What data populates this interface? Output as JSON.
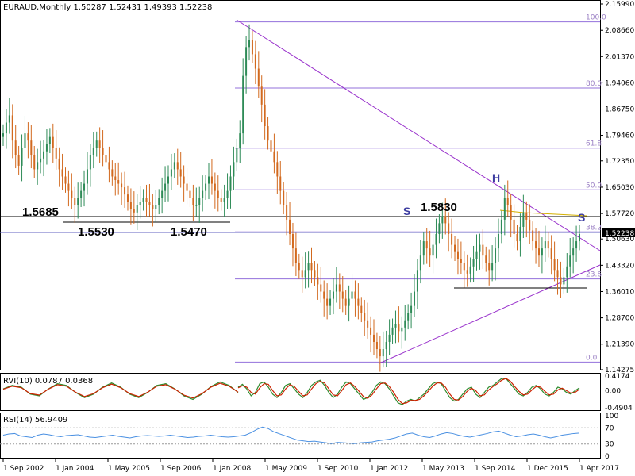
{
  "header": {
    "main": "EURAUD,Monthly  1.50287 1.52431 1.49393 1.52238",
    "rvi": "RVI(10) 0.0787 0.0368",
    "rsi": "RSI(14) 56.9409"
  },
  "current_price": "1.52238",
  "colors": {
    "bull": "#2e8b57",
    "bear": "#d2691e",
    "fib": "#9370db",
    "trend": "#9932cc",
    "support": "#000000",
    "rvi_main": "#2e8b2e",
    "rvi_signal": "#cc2200",
    "rsi": "#4a90e2",
    "pattern_text": "#3c3ca0"
  },
  "chart_data": [
    {
      "type": "candlestick",
      "symbol": "EURAUD",
      "timeframe": "Monthly",
      "ylim": [
        1.1427,
        2.1599
      ],
      "y_ticks": [
        "2.15990",
        "2.08660",
        "2.01370",
        "1.94060",
        "1.86750",
        "1.79460",
        "1.72350",
        "1.65030",
        "1.57720",
        "1.50630",
        "1.43320",
        "1.36010",
        "1.28700",
        "1.21390",
        "1.14275"
      ],
      "x_ticks": [
        "1 Sep 2002",
        "1 Jan 2004",
        "1 May 2005",
        "1 Sep 2006",
        "1 Jan 2008",
        "1 May 2009",
        "1 Sep 2010",
        "1 Jan 2012",
        "1 May 2013",
        "1 Sep 2014",
        "1 Dec 2015",
        "1 Apr 2017"
      ],
      "close_series": [
        1.8,
        1.83,
        1.85,
        1.78,
        1.74,
        1.71,
        1.76,
        1.8,
        1.78,
        1.74,
        1.7,
        1.72,
        1.73,
        1.75,
        1.77,
        1.79,
        1.76,
        1.73,
        1.7,
        1.68,
        1.66,
        1.64,
        1.62,
        1.6,
        1.62,
        1.64,
        1.66,
        1.7,
        1.74,
        1.76,
        1.78,
        1.76,
        1.74,
        1.72,
        1.7,
        1.68,
        1.67,
        1.66,
        1.65,
        1.63,
        1.61,
        1.59,
        1.58,
        1.6,
        1.61,
        1.62,
        1.61,
        1.6,
        1.59,
        1.6,
        1.62,
        1.64,
        1.66,
        1.68,
        1.7,
        1.72,
        1.7,
        1.68,
        1.66,
        1.64,
        1.62,
        1.6,
        1.6,
        1.62,
        1.64,
        1.66,
        1.68,
        1.66,
        1.64,
        1.62,
        1.61,
        1.62,
        1.64,
        1.68,
        1.72,
        1.76,
        1.8,
        1.96,
        2.04,
        2.06,
        2.02,
        1.98,
        1.93,
        1.88,
        1.82,
        1.78,
        1.75,
        1.72,
        1.68,
        1.64,
        1.6,
        1.56,
        1.52,
        1.48,
        1.44,
        1.42,
        1.4,
        1.42,
        1.44,
        1.42,
        1.4,
        1.38,
        1.36,
        1.34,
        1.32,
        1.34,
        1.36,
        1.38,
        1.36,
        1.34,
        1.32,
        1.34,
        1.36,
        1.34,
        1.32,
        1.3,
        1.28,
        1.26,
        1.24,
        1.22,
        1.2,
        1.18,
        1.2,
        1.22,
        1.24,
        1.26,
        1.27,
        1.25,
        1.26,
        1.28,
        1.3,
        1.32,
        1.36,
        1.42,
        1.46,
        1.5,
        1.48,
        1.46,
        1.49,
        1.52,
        1.55,
        1.57,
        1.55,
        1.52,
        1.49,
        1.47,
        1.45,
        1.44,
        1.42,
        1.41,
        1.43,
        1.45,
        1.47,
        1.49,
        1.46,
        1.44,
        1.42,
        1.44,
        1.48,
        1.52,
        1.56,
        1.62,
        1.6,
        1.56,
        1.52,
        1.5,
        1.54,
        1.58,
        1.56,
        1.53,
        1.5,
        1.48,
        1.46,
        1.48,
        1.5,
        1.48,
        1.45,
        1.42,
        1.4,
        1.38,
        1.4,
        1.43,
        1.46,
        1.48,
        1.5,
        1.52
      ],
      "annotations": [
        "1.5685",
        "1.5530",
        "1.5470",
        "1.5830",
        "S",
        "H",
        "S"
      ],
      "fibonacci_levels": [
        {
          "label": "100.0",
          "value": 2.11
        },
        {
          "label": "80.0",
          "value": 1.926
        },
        {
          "label": "61.8",
          "value": 1.759
        },
        {
          "label": "50.0",
          "value": 1.643
        },
        {
          "label": "38.2",
          "value": 1.526
        },
        {
          "label": "23.6",
          "value": 1.395
        },
        {
          "label": "0.0",
          "value": 1.164
        }
      ]
    },
    {
      "type": "line",
      "name": "RVI(10)",
      "y_ticks": [
        "0.4174",
        "0.00",
        "-0.4904"
      ],
      "ylim": [
        -0.4904,
        0.4174
      ],
      "series": [
        {
          "name": "main",
          "values": [
            0.1,
            0.18,
            0.05,
            -0.15,
            -0.05,
            0.2,
            0.25,
            0.1,
            -0.1,
            -0.2,
            -0.05,
            0.15,
            0.2,
            0.05,
            -0.1,
            -0.2,
            -0.05,
            0.15,
            0.25,
            0.3,
            0.15,
            -0.05,
            -0.2,
            -0.1,
            0.1,
            0.25,
            0.2,
            0.05,
            -0.1,
            -0.25,
            -0.2,
            -0.05,
            0.15,
            0.25,
            0.2,
            0.05,
            -0.15,
            -0.35,
            -0.4,
            -0.3,
            -0.25,
            -0.3,
            -0.2,
            -0.1,
            0.05,
            0.2,
            0.25,
            0.2,
            0.0,
            -0.2,
            -0.3,
            -0.25,
            -0.1,
            0.05,
            0.1,
            -0.1,
            -0.2,
            -0.05,
            0.1,
            0.15,
            0.25,
            0.35,
            0.35,
            0.2,
            0.05,
            -0.1,
            -0.15,
            -0.05,
            0.1,
            0.15,
            0.05,
            -0.1,
            -0.15,
            -0.05,
            0.1,
            0.05,
            -0.05,
            -0.1,
            0.0,
            0.08
          ]
        },
        {
          "name": "signal",
          "values": [
            0.08,
            0.14,
            0.1,
            -0.05,
            -0.1,
            0.08,
            0.2,
            0.18,
            0.0,
            -0.15,
            -0.12,
            0.05,
            0.17,
            0.12,
            -0.02,
            -0.15,
            -0.12,
            0.05,
            0.2,
            0.27,
            0.22,
            0.05,
            -0.12,
            -0.15,
            0.0,
            0.17,
            0.22,
            0.12,
            -0.02,
            -0.17,
            -0.22,
            -0.12,
            0.05,
            0.2,
            0.22,
            0.12,
            -0.05,
            -0.25,
            -0.37,
            -0.35,
            -0.28,
            -0.28,
            -0.25,
            -0.15,
            -0.02,
            0.12,
            0.22,
            0.22,
            0.1,
            -0.1,
            -0.25,
            -0.27,
            -0.17,
            -0.02,
            0.07,
            0.0,
            -0.15,
            -0.12,
            0.02,
            0.12,
            0.2,
            0.3,
            0.35,
            0.27,
            0.12,
            -0.02,
            -0.12,
            -0.1,
            0.02,
            0.12,
            0.1,
            -0.02,
            -0.12,
            -0.1,
            0.02,
            0.07,
            0.0,
            -0.07,
            -0.05,
            0.04
          ]
        }
      ]
    },
    {
      "type": "line",
      "name": "RSI(14)",
      "y_ticks": [
        "100",
        "70",
        "30",
        "0"
      ],
      "ylim": [
        0,
        100
      ],
      "levels": [
        70,
        30
      ],
      "series": [
        {
          "name": "RSI",
          "values": [
            52,
            55,
            56,
            50,
            48,
            46,
            52,
            55,
            53,
            50,
            48,
            51,
            52,
            53,
            50,
            47,
            46,
            48,
            50,
            52,
            49,
            47,
            45,
            48,
            50,
            51,
            50,
            49,
            50,
            52,
            50,
            48,
            46,
            47,
            49,
            50,
            52,
            50,
            48,
            47,
            48,
            50,
            52,
            58,
            66,
            72,
            68,
            60,
            55,
            50,
            45,
            40,
            38,
            36,
            37,
            35,
            33,
            31,
            34,
            33,
            32,
            31,
            33,
            34,
            35,
            38,
            40,
            42,
            45,
            50,
            55,
            57,
            52,
            48,
            46,
            50,
            55,
            58,
            56,
            52,
            49,
            47,
            50,
            53,
            56,
            60,
            62,
            57,
            52,
            48,
            50,
            53,
            55,
            52,
            48,
            45,
            48,
            52,
            54,
            56,
            57
          ]
        }
      ]
    }
  ]
}
